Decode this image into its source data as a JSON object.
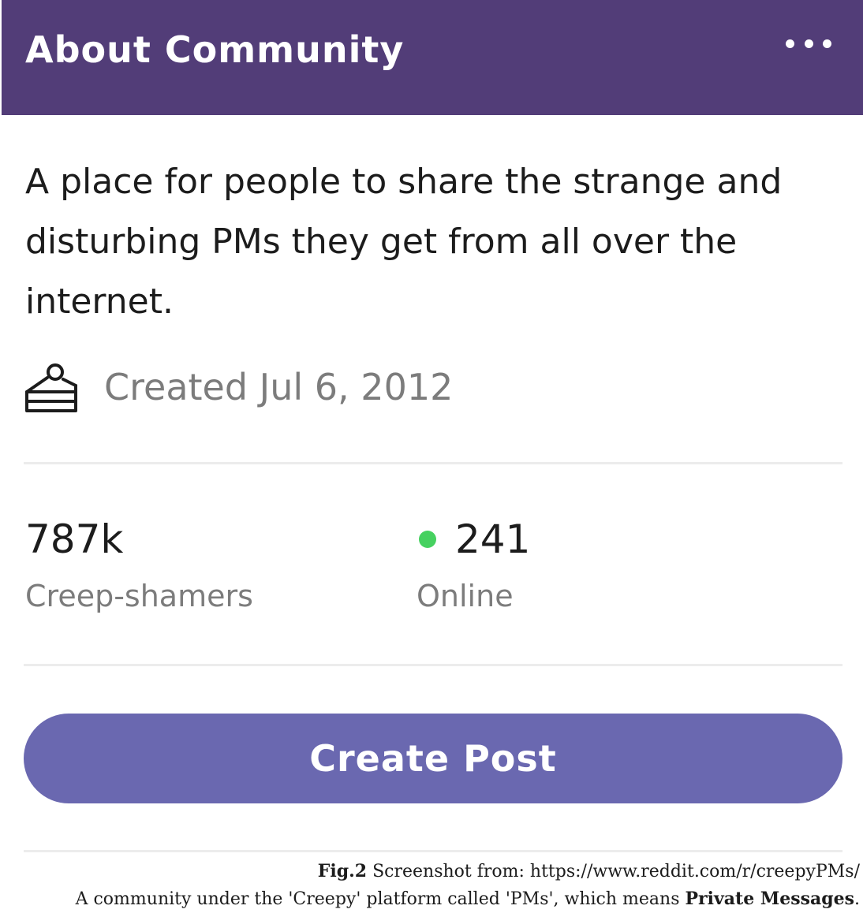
{
  "header": {
    "title": "About Community",
    "menu_icon": "more-horizontal-icon",
    "background_color": "#523d78"
  },
  "description": "A place for people to share the strange and disturbing PMs they get from all over the internet.",
  "created": {
    "icon": "cake-icon",
    "text": "Created Jul 6, 2012"
  },
  "stats": {
    "members": {
      "value": "787k",
      "label": "Creep-shamers"
    },
    "online": {
      "value": "241",
      "label": "Online",
      "indicator_color": "#46d160"
    }
  },
  "create_post": {
    "label": "Create Post",
    "color": "#6a68b0"
  },
  "caption": {
    "fig_label": "Fig.2",
    "line1_text": " Screenshot from: https://www.reddit.com/r/creepyPMs/",
    "line2_text": "A community under the 'Creepy' platform called 'PMs', which means ",
    "line2_bold": "Private Messages",
    "line2_end": "."
  }
}
